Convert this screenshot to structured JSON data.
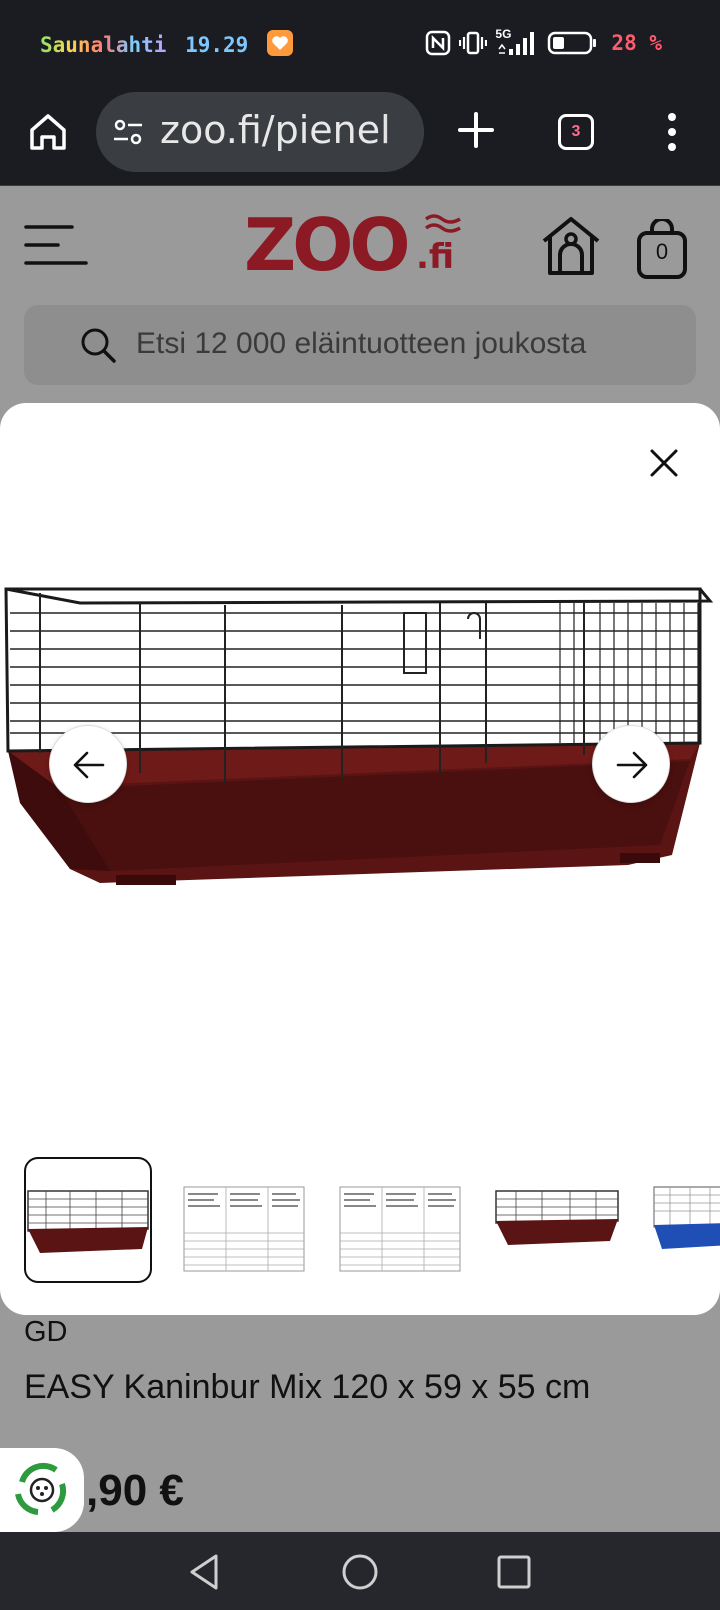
{
  "status_bar": {
    "carrier": "Saunalahti",
    "time": "19.29",
    "network": "5G",
    "battery_percent": "28 %",
    "colors": {
      "carrier": [
        "#7be26a",
        "#ff7a4d",
        "#ffd54a",
        "#69c5ff",
        "#ff6ea0",
        "#b48cff",
        "#6be0b6",
        "#ff9f43",
        "#ffe066",
        "#7ad7ff"
      ],
      "time": "#7ec8ff",
      "battery": "#ff5a6e"
    }
  },
  "browser": {
    "url": "zoo.fi/pienel",
    "tab_count": "3",
    "icons": {
      "home": "home-icon",
      "site_settings": "tune-icon",
      "new_tab": "plus-icon",
      "tabs": "tab-switcher-icon",
      "menu": "more-vert-icon"
    }
  },
  "site": {
    "logo_text": "ZOO",
    "logo_suffix": ".fi",
    "brand_color": "#a01e2a",
    "cart_count": "0",
    "search_placeholder": "Etsi 12 000 eläintuotteen joukosta"
  },
  "gallery": {
    "thumbnail_count": 5,
    "active_index": 0,
    "icons": {
      "close": "close-icon",
      "prev": "arrow-left-icon",
      "next": "arrow-right-icon"
    }
  },
  "product": {
    "brand": "GD",
    "title": "EASY Kaninbur Mix 120 x 59 x 55 cm",
    "price_visible": ",90 €"
  },
  "nav": {
    "icons": [
      "back-icon",
      "home-circle-icon",
      "recents-icon"
    ]
  }
}
